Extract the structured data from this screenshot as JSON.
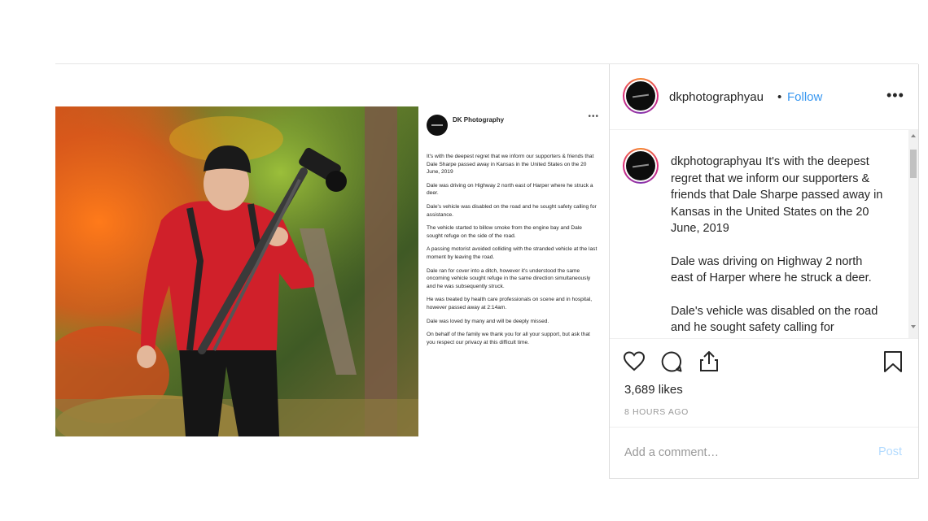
{
  "post_image": {
    "text_panel": {
      "author": "DK Photography",
      "more_label": "•••",
      "paragraphs": [
        "It's with the deepest regret that we inform our supporters & friends that Dale Sharpe passed away in Kansas in the United States on the 20 June, 2019",
        "Dale was driving on Highway 2 north east of Harper where he struck a deer.",
        "Dale's vehicle was disabled on the road and he sought safety calling for assistance.",
        "The vehicle started to billow smoke from the engine bay and Dale sought refuge on the side of the road.",
        "A passing motorist avoided colliding with the stranded vehicle at the last moment by leaving the road.",
        "Dale ran for cover into a ditch, however it's understood the same oncoming vehicle sought refuge in the same direction simultaneously and he was subsequently struck.",
        "He was treated by health care professionals on scene and in hospital, however passed away at 2:14am.",
        "Dale was loved by many and will be deeply missed.",
        "On behalf of the family we thank you for all your support, but ask that you respect our privacy at this difficult time."
      ]
    }
  },
  "header": {
    "username": "dkphotographyau",
    "separator": "•",
    "follow_label": "Follow",
    "more_label": "•••"
  },
  "caption": {
    "username": "dkphotographyau",
    "first_line": "It's with the deepest regret that we inform our supporters & friends that Dale Sharpe passed away in Kansas in the United States on the 20 June, 2019",
    "para2": "Dale was driving on Highway 2 north east of Harper where he struck a deer.",
    "para3": "Dale's vehicle was disabled on the road and he sought safety calling for assistance."
  },
  "actions": {
    "likes": "3,689 likes",
    "timestamp": "8 HOURS AGO"
  },
  "comment_box": {
    "placeholder": "Add a comment…",
    "post_label": "Post"
  },
  "colors": {
    "link_blue": "#3897f0",
    "post_disabled": "#b3dbff",
    "jacket_red": "#d0202a"
  }
}
